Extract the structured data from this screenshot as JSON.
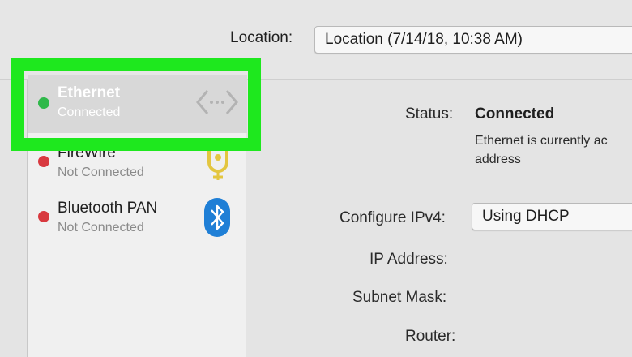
{
  "toolbar": {
    "location_label": "Location:",
    "location_value": "Location (7/14/18, 10:38 AM)"
  },
  "services": [
    {
      "name": "Ethernet",
      "status": "Connected",
      "dot_color": "#2fb84a",
      "icon": "ethernet-arrows-icon"
    },
    {
      "name": "FireWire",
      "status": "Not Connected",
      "dot_color": "#d8393f",
      "icon": "firewire-icon"
    },
    {
      "name": "Bluetooth PAN",
      "status": "Not Connected",
      "dot_color": "#d8393f",
      "icon": "bluetooth-icon"
    }
  ],
  "detail": {
    "status_label": "Status:",
    "status_value": "Connected",
    "status_description": "Ethernet  is currently ac address",
    "configure_ipv4_label": "Configure IPv4:",
    "configure_ipv4_value": "Using DHCP",
    "ip_address_label": "IP Address:",
    "subnet_mask_label": "Subnet Mask:",
    "router_label": "Router:"
  },
  "colors": {
    "highlight": "#1ee81e",
    "connected": "#2fb84a",
    "not_connected": "#d8393f",
    "bluetooth": "#1f7fd6",
    "firewire": "#e3c640"
  }
}
